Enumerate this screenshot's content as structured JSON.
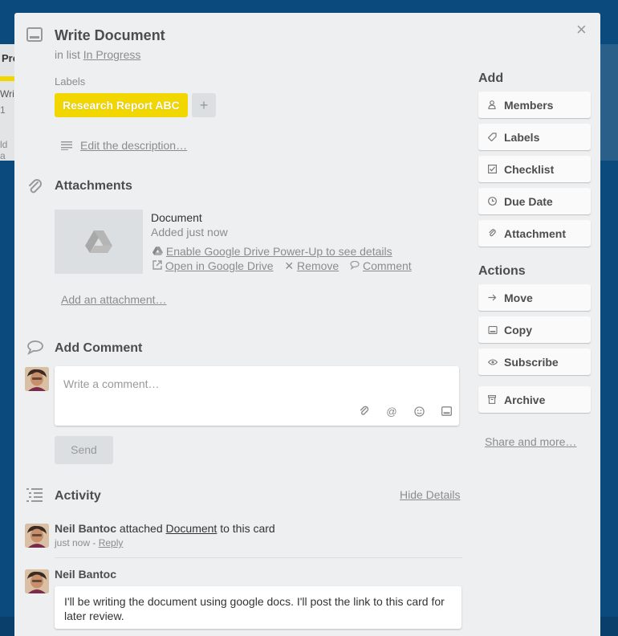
{
  "background": {
    "list_title_fragment": "Pro",
    "card_title_fragment": "Write",
    "badge_fragment": "1",
    "add_fragment": "ld a"
  },
  "card": {
    "title": "Write Document",
    "in_list_prefix": "in list",
    "list_name": "In Progress",
    "close_glyph": "×"
  },
  "labels": {
    "heading": "Labels",
    "items": [
      {
        "name": "Research Report ABC",
        "color": "#f2d600"
      }
    ],
    "add_glyph": "+"
  },
  "description": {
    "edit_link": "Edit the description…"
  },
  "attachments": {
    "heading": "Attachments",
    "items": [
      {
        "name": "Document",
        "added": "Added just now",
        "enable_powerup": "Enable Google Drive Power-Up to see details",
        "open_link": "Open in Google Drive",
        "remove_link": "Remove",
        "comment_link": "Comment"
      }
    ],
    "add_link": "Add an attachment…"
  },
  "add_comment": {
    "heading": "Add Comment",
    "placeholder": "Write a comment…",
    "send_label": "Send"
  },
  "activity": {
    "heading": "Activity",
    "hide_details": "Hide Details",
    "items": [
      {
        "author": "Neil Bantoc",
        "action_text": "attached",
        "target": "Document",
        "suffix": "to this card",
        "time": "just now",
        "separator": "-",
        "reply": "Reply"
      },
      {
        "author": "Neil Bantoc",
        "comment": "I'll be writing the document using google docs. I'll post the link to this card for later review."
      }
    ]
  },
  "sidebar": {
    "add_heading": "Add",
    "add_buttons": [
      {
        "label": "Members",
        "icon": "person-icon"
      },
      {
        "label": "Labels",
        "icon": "tag-icon"
      },
      {
        "label": "Checklist",
        "icon": "checkbox-icon"
      },
      {
        "label": "Due Date",
        "icon": "clock-icon"
      },
      {
        "label": "Attachment",
        "icon": "paperclip-icon"
      }
    ],
    "actions_heading": "Actions",
    "action_buttons": [
      {
        "label": "Move",
        "icon": "arrow-right-icon"
      },
      {
        "label": "Copy",
        "icon": "card-icon"
      },
      {
        "label": "Subscribe",
        "icon": "eye-icon"
      },
      {
        "label": "Archive",
        "icon": "archive-icon"
      }
    ],
    "share_link": "Share and more…"
  },
  "colors": {
    "board_bg": "#0b4a7d",
    "modal_bg": "#edeff0",
    "label_yellow": "#f2d600"
  }
}
